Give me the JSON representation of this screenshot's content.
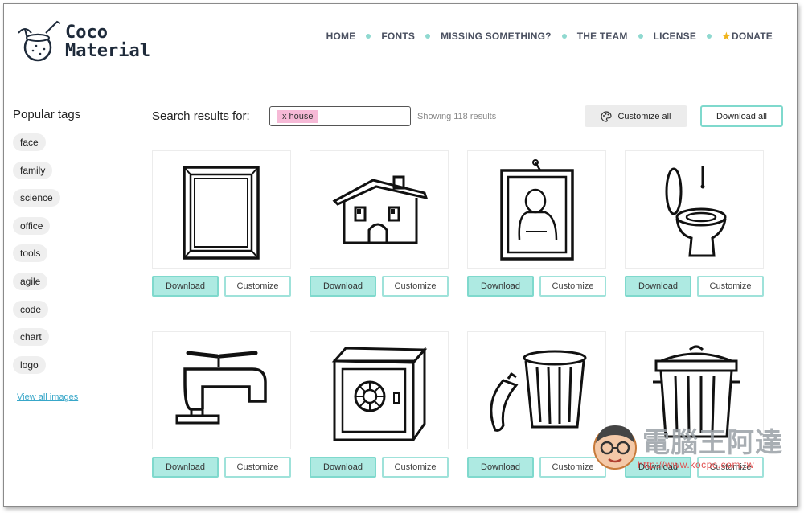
{
  "header": {
    "logo_line1": "Coco",
    "logo_line2": "Material",
    "nav": [
      "HOME",
      "FONTS",
      "MISSING SOMETHING?",
      "THE TEAM",
      "LICENSE",
      "DONATE"
    ]
  },
  "sidebar": {
    "title": "Popular tags",
    "tags": [
      "face",
      "family",
      "science",
      "office",
      "tools",
      "agile",
      "code",
      "chart",
      "logo"
    ],
    "view_all": "View all images"
  },
  "search": {
    "label": "Search results for:",
    "chip": "x house",
    "result_count": "Showing 118 results",
    "customize_all": "Customize all",
    "download_all": "Download all"
  },
  "cards": [
    {
      "icon": "picture-frame-icon",
      "download": "Download",
      "customize": "Customize"
    },
    {
      "icon": "house-icon",
      "download": "Download",
      "customize": "Customize"
    },
    {
      "icon": "framed-portrait-icon",
      "download": "Download",
      "customize": "Customize"
    },
    {
      "icon": "toilet-icon",
      "download": "Download",
      "customize": "Customize"
    },
    {
      "icon": "faucet-icon",
      "download": "Download",
      "customize": "Customize"
    },
    {
      "icon": "safe-icon",
      "download": "Download",
      "customize": "Customize"
    },
    {
      "icon": "open-trash-can-icon",
      "download": "Download",
      "customize": "Customize"
    },
    {
      "icon": "trash-can-icon",
      "download": "Download",
      "customize": "Customize"
    }
  ],
  "watermark": {
    "title": "電腦王阿達",
    "url": "http://www.kocpc.com.tw"
  },
  "colors": {
    "accent_teal": "#7fd9cd",
    "download_fill": "#aeeae2",
    "chip_pink": "#f6b9d6",
    "link_blue": "#38a7c9"
  }
}
